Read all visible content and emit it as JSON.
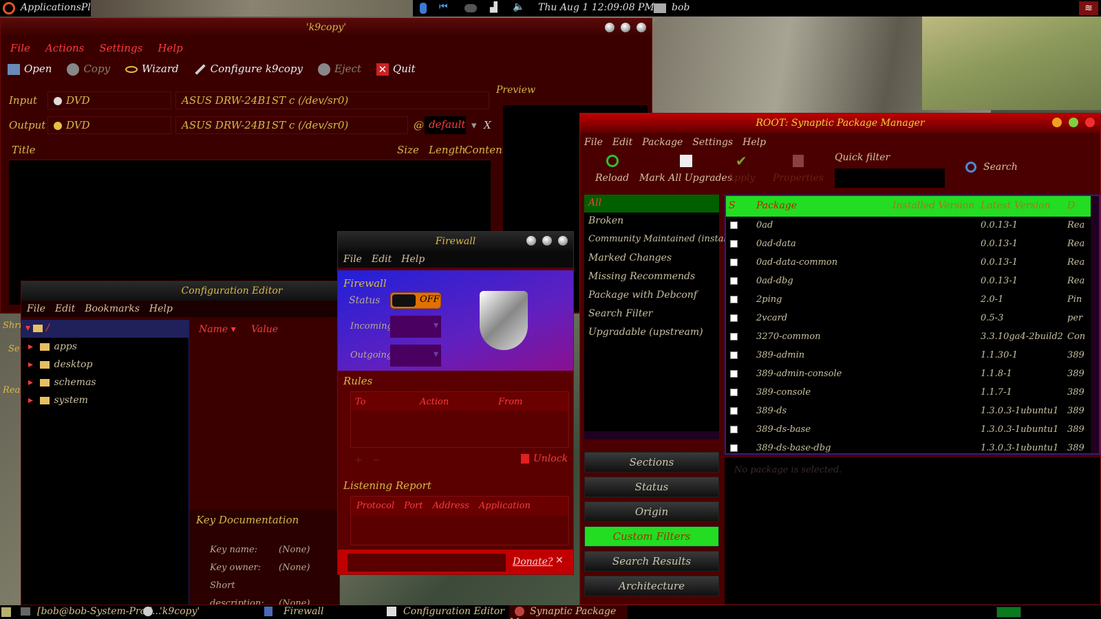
{
  "topbar": {
    "app_menus": "ApplicationsPlaces",
    "clock": "Thu Aug  1 12:09:08 PM",
    "user": "bob"
  },
  "k9copy": {
    "title": "k9copy",
    "menu": [
      "File",
      "Actions",
      "Settings",
      "Help"
    ],
    "toolbar": {
      "open": "Open",
      "copy": "Copy",
      "wizard": "Wizard",
      "configure": "Configure k9copy",
      "eject": "Eject",
      "quit": "Quit"
    },
    "input_label": "Input",
    "output_label": "Output",
    "input_type": "DVD",
    "output_type": "DVD",
    "input_device": "ASUS   DRW-24B1ST   c  (/dev/sr0)",
    "output_device": "ASUS   DRW-24B1ST   c  (/dev/sr0)",
    "at": "@",
    "default_value": "default",
    "x": "X",
    "columns": {
      "title": "Title",
      "size": "Size",
      "length": "Length",
      "content": "Content"
    },
    "preview": "Preview",
    "side_peek": [
      "Shri",
      "Se",
      "Rea"
    ]
  },
  "firewall": {
    "title": "Firewall",
    "menu": [
      "File",
      "Edit",
      "Help"
    ],
    "section": "Firewall",
    "status_label": "Status",
    "status_value": "OFF",
    "incoming": "Incoming:",
    "outgoing": "Outgoing:",
    "rules": "Rules",
    "rules_cols": [
      "To",
      "Action",
      "From"
    ],
    "unlock": "Unlock",
    "listening": "Listening Report",
    "listening_cols": [
      "Protocol",
      "Port",
      "Address",
      "Application"
    ],
    "donate": "Donate?"
  },
  "config": {
    "title": "Configuration Editor",
    "menu": [
      "File",
      "Edit",
      "Bookmarks",
      "Help"
    ],
    "root": "/",
    "tree": [
      "apps",
      "desktop",
      "schemas",
      "system"
    ],
    "col_name": "Name",
    "col_value": "Value",
    "keydoc": "Key Documentation",
    "key_name_label": "Key name:",
    "key_owner_label": "Key owner:",
    "short_desc_label": "Short description:",
    "none": "(None)"
  },
  "synaptic": {
    "title": "ROOT: Synaptic Package Manager",
    "menu": [
      "File",
      "Edit",
      "Package",
      "Settings",
      "Help"
    ],
    "toolbar": {
      "reload": "Reload",
      "mark_all": "Mark All Upgrades",
      "apply": "Apply",
      "properties": "Properties",
      "quick_filter": "Quick filter",
      "search": "Search"
    },
    "filters": [
      "All",
      "Broken",
      "Community Maintained (installed)",
      "Marked Changes",
      "Missing Recommends",
      "Package with Debconf",
      "Search Filter",
      "Upgradable (upstream)"
    ],
    "side_buttons": [
      "Sections",
      "Status",
      "Origin",
      "Custom Filters",
      "Search Results",
      "Architecture"
    ],
    "columns": {
      "s": "S",
      "package": "Package",
      "installed": "Installed Version",
      "latest": "Latest Version",
      "desc": "D"
    },
    "packages": [
      {
        "name": "0ad",
        "latest": "0.0.13-1",
        "desc": "Rea"
      },
      {
        "name": "0ad-data",
        "latest": "0.0.13-1",
        "desc": "Rea"
      },
      {
        "name": "0ad-data-common",
        "latest": "0.0.13-1",
        "desc": "Rea"
      },
      {
        "name": "0ad-dbg",
        "latest": "0.0.13-1",
        "desc": "Rea"
      },
      {
        "name": "2ping",
        "latest": "2.0-1",
        "desc": "Pin"
      },
      {
        "name": "2vcard",
        "latest": "0.5-3",
        "desc": "per"
      },
      {
        "name": "3270-common",
        "latest": "3.3.10ga4-2build2",
        "desc": "Con"
      },
      {
        "name": "389-admin",
        "latest": "1.1.30-1",
        "desc": "389"
      },
      {
        "name": "389-admin-console",
        "latest": "1.1.8-1",
        "desc": "389"
      },
      {
        "name": "389-console",
        "latest": "1.1.7-1",
        "desc": "389"
      },
      {
        "name": "389-ds",
        "latest": "1.3.0.3-1ubuntu1",
        "desc": "389"
      },
      {
        "name": "389-ds-base",
        "latest": "1.3.0.3-1ubuntu1",
        "desc": "389"
      },
      {
        "name": "389-ds-base-dbg",
        "latest": "1.3.0.3-1ubuntu1",
        "desc": "389"
      }
    ],
    "no_selection": "No package is selected."
  },
  "taskbar": {
    "items": [
      "[bob@bob-System-Prod...",
      "k9copy",
      "Firewall",
      "Configuration Editor",
      "Synaptic Package Man..."
    ]
  },
  "colors": {
    "accent_red": "#ff3a3a",
    "green_active": "#22dd22",
    "gold": "#d8b84a"
  }
}
